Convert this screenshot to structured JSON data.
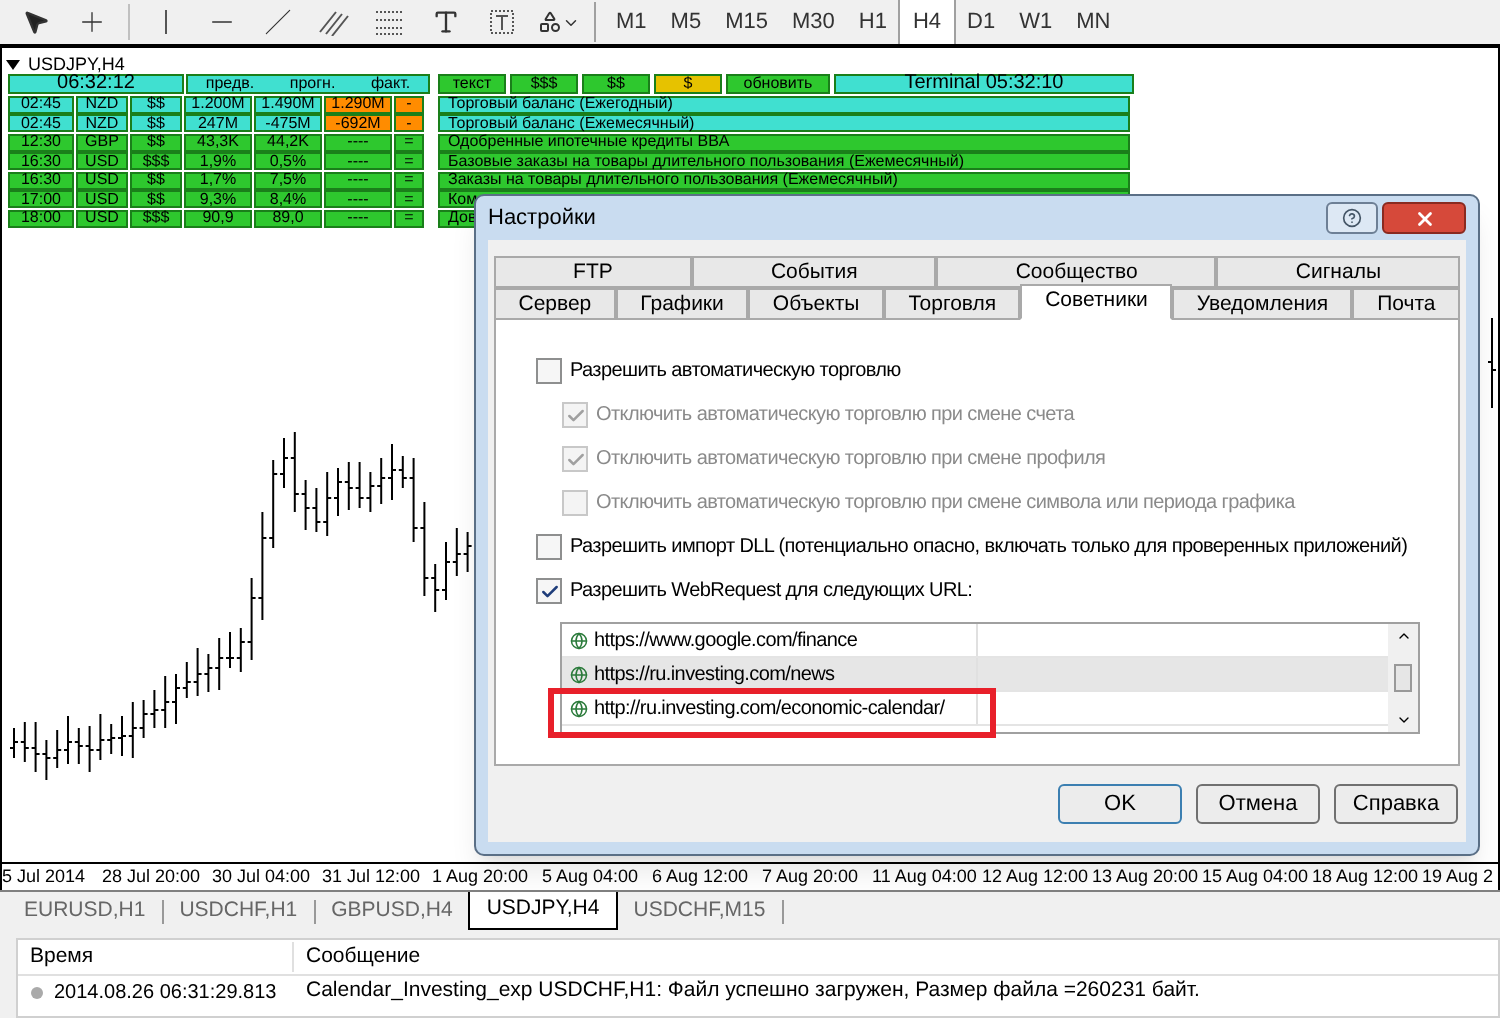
{
  "toolbar": {
    "timeframes": [
      {
        "label": "M1",
        "selected": false
      },
      {
        "label": "M5",
        "selected": false
      },
      {
        "label": "M15",
        "selected": false
      },
      {
        "label": "M30",
        "selected": false
      },
      {
        "label": "H1",
        "selected": false
      },
      {
        "label": "H4",
        "selected": true
      },
      {
        "label": "D1",
        "selected": false
      },
      {
        "label": "W1",
        "selected": false
      },
      {
        "label": "MN",
        "selected": false
      }
    ]
  },
  "chart": {
    "title": "USDJPY,H4",
    "x_labels": [
      "5 Jul 2014",
      "28 Jul 20:00",
      "30 Jul 04:00",
      "31 Jul 12:00",
      "1 Aug 20:00",
      "5 Aug 04:00",
      "6 Aug 12:00",
      "7 Aug 20:00",
      "11 Aug 04:00",
      "12 Aug 12:00",
      "13 Aug 20:00",
      "15 Aug 04:00",
      "18 Aug 12:00",
      "19 Aug 2"
    ]
  },
  "calendar_widget": {
    "clock": "06:32:12",
    "headers": [
      "предв.",
      "прогн.",
      "факт."
    ],
    "buttons": [
      {
        "label": "текст",
        "color": "#2ec82e"
      },
      {
        "label": "$$$",
        "color": "#2ec82e"
      },
      {
        "label": "$$",
        "color": "#2ec82e"
      },
      {
        "label": "$",
        "color": "#e6c200"
      },
      {
        "label": "обновить",
        "color": "#2ec82e"
      }
    ],
    "terminal": "Terminal 05:32:10",
    "events": [
      {
        "time": "02:45",
        "currency": "NZD",
        "importance": "$$",
        "previous": "1.200M",
        "forecast": "1.490M",
        "actual": {
          "value": "1.290M",
          "color": "#ff8c00"
        },
        "sign": "-",
        "title": "Торговый баланс (Ежегодный)",
        "color": "#40e0d0"
      },
      {
        "time": "02:45",
        "currency": "NZD",
        "importance": "$$",
        "previous": "247M",
        "forecast": "-475M",
        "actual": {
          "value": "-692M",
          "color": "#ff8c00"
        },
        "sign": "-",
        "title": "Торговый баланс (Ежемесячный)",
        "color": "#40e0d0"
      },
      {
        "time": "12:30",
        "currency": "GBP",
        "importance": "$$",
        "previous": "43,3K",
        "forecast": "44,2K",
        "actual": {
          "value": "----",
          "color": "#2ec82e"
        },
        "sign": "=",
        "title": "Одобренные ипотечные кредиты BBA",
        "color": "#2ec82e"
      },
      {
        "time": "16:30",
        "currency": "USD",
        "importance": "$$$",
        "previous": "1,9%",
        "forecast": "0,5%",
        "actual": {
          "value": "----",
          "color": "#2ec82e"
        },
        "sign": "=",
        "title": "Базовые заказы на товары длительного пользования (Ежемесячный)",
        "color": "#2ec82e"
      },
      {
        "time": "16:30",
        "currency": "USD",
        "importance": "$$",
        "previous": "1,7%",
        "forecast": "7,5%",
        "actual": {
          "value": "----",
          "color": "#2ec82e"
        },
        "sign": "=",
        "title": "Заказы на товары длительного пользования (Ежемесячный)",
        "color": "#2ec82e"
      },
      {
        "time": "17:00",
        "currency": "USD",
        "importance": "$$",
        "previous": "9,3%",
        "forecast": "8,4%",
        "actual": {
          "value": "----",
          "color": "#2ec82e"
        },
        "sign": "=",
        "title": "Ком",
        "color": "#2ec82e"
      },
      {
        "time": "18:00",
        "currency": "USD",
        "importance": "$$$",
        "previous": "90,9",
        "forecast": "89,0",
        "actual": {
          "value": "----",
          "color": "#2ec82e"
        },
        "sign": "=",
        "title": "Дов",
        "color": "#2ec82e"
      }
    ]
  },
  "dialog": {
    "title": "Настройки",
    "tab_rows": [
      [
        {
          "label": "FTP",
          "selected": false
        },
        {
          "label": "События",
          "selected": false
        },
        {
          "label": "Сообщество",
          "selected": false
        },
        {
          "label": "Сигналы",
          "selected": false
        }
      ],
      [
        {
          "label": "Сервер",
          "selected": false
        },
        {
          "label": "Графики",
          "selected": false
        },
        {
          "label": "Объекты",
          "selected": false
        },
        {
          "label": "Торговля",
          "selected": false
        },
        {
          "label": "Советники",
          "selected": true
        },
        {
          "label": "Уведомления",
          "selected": false
        },
        {
          "label": "Почта",
          "selected": false
        }
      ]
    ],
    "options": [
      {
        "label": "Разрешить автоматическую торговлю",
        "checked": false,
        "disabled": false,
        "children": [
          {
            "label": "Отключить автоматическую торговлю при смене счета",
            "checked": true,
            "disabled": true
          },
          {
            "label": "Отключить автоматическую торговлю при смене профиля",
            "checked": true,
            "disabled": true
          },
          {
            "label": "Отключить автоматическую торговлю при смене символа или периода графика",
            "checked": false,
            "disabled": true
          }
        ]
      },
      {
        "label": "Разрешить импорт DLL (потенциально опасно, включать только для проверенных приложений)",
        "checked": false,
        "disabled": false
      },
      {
        "label": "Разрешить WebRequest для следующих URL:",
        "checked": true,
        "disabled": false
      }
    ],
    "url_list": [
      {
        "url": "https://www.google.com/finance",
        "selected": false,
        "highlighted": false
      },
      {
        "url": "https://ru.investing.com/news",
        "selected": true,
        "highlighted": false
      },
      {
        "url": "http://ru.investing.com/economic-calendar/",
        "selected": false,
        "highlighted": true
      }
    ],
    "buttons": [
      {
        "label": "OK",
        "default": true
      },
      {
        "label": "Отмена",
        "default": false
      },
      {
        "label": "Справка",
        "default": false
      }
    ]
  },
  "chart_tabs": [
    {
      "label": "EURUSD,H1",
      "selected": false
    },
    {
      "label": "USDCHF,H1",
      "selected": false
    },
    {
      "label": "GBPUSD,H4",
      "selected": false
    },
    {
      "label": "USDJPY,H4",
      "selected": true
    },
    {
      "label": "USDCHF,M15",
      "selected": false
    }
  ],
  "log": {
    "columns": [
      "Время",
      "Сообщение"
    ],
    "rows": [
      {
        "time": "2014.08.26 06:31:29.813",
        "message": "Calendar_Investing_exp USDCHF,H1: Файл успешно загружен, Размер файла =260231 байт."
      }
    ]
  }
}
